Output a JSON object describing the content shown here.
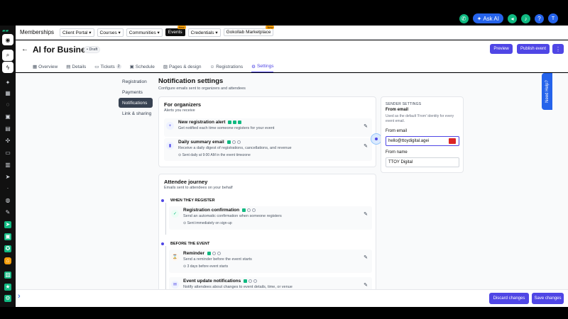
{
  "topbar": {
    "ask_ai": "Ask AI",
    "avatar": "T"
  },
  "appbar": {
    "title": "Memberships",
    "nav": [
      {
        "label": "Client Portal ▾",
        "badge": ""
      },
      {
        "label": "Courses ▾",
        "badge": ""
      },
      {
        "label": "Communities ▾",
        "badge": ""
      },
      {
        "label": "Events",
        "badge": "New"
      },
      {
        "label": "Credentials ▾",
        "badge": ""
      },
      {
        "label": "Gokollab Marketplace",
        "badge": "New"
      }
    ]
  },
  "header": {
    "title": "AI for Business",
    "status": "• Draft",
    "preview": "Preview",
    "publish": "Publish event",
    "more": "⋮"
  },
  "tabs": [
    {
      "label": "Overview",
      "icon": "grid-icon",
      "glyph": "▦",
      "count": ""
    },
    {
      "label": "Details",
      "icon": "doc-icon",
      "glyph": "▤",
      "count": ""
    },
    {
      "label": "Tickets",
      "icon": "ticket-icon",
      "glyph": "▭",
      "count": "2"
    },
    {
      "label": "Schedule",
      "icon": "calendar-icon",
      "glyph": "▣",
      "count": ""
    },
    {
      "label": "Pages & design",
      "icon": "image-icon",
      "glyph": "▨",
      "count": ""
    },
    {
      "label": "Registrations",
      "icon": "people-icon",
      "glyph": "☺",
      "count": ""
    },
    {
      "label": "Settings",
      "icon": "gear-icon",
      "glyph": "⚙",
      "count": ""
    }
  ],
  "settings_nav": [
    "Registration",
    "Payments",
    "Notifications",
    "Link & sharing"
  ],
  "section": {
    "title": "Notification settings",
    "subtitle": "Configure emails sent to organizers and attendees"
  },
  "organizers": {
    "title": "For organizers",
    "subtitle": "Alerts you receive",
    "items": [
      {
        "name": "New registration alert",
        "desc": "Get notified each time someone registers for your event",
        "time": "",
        "glyph": "+"
      },
      {
        "name": "Daily summary email",
        "desc": "Receive a daily digest of registrations, cancellations, and revenue",
        "time": "⊙ Sent daily at 9:00 AM in the event timezone",
        "glyph": "▮"
      }
    ]
  },
  "attendees": {
    "title": "Attendee journey",
    "subtitle": "Emails sent to attendees on your behalf",
    "phases": [
      {
        "label": "WHEN THEY REGISTER"
      },
      {
        "label": "BEFORE THE EVENT"
      }
    ],
    "items": [
      {
        "name": "Registration confirmation",
        "desc": "Send an automatic confirmation when someone registers",
        "time": "⊙ Sent immediately on sign-up",
        "glyph": "✓"
      },
      {
        "name": "Reminder",
        "desc": "Send a reminder before the event starts",
        "time": "⊙ 3 days before event starts",
        "glyph": "⌛"
      },
      {
        "name": "Event update notifications",
        "desc": "Notify attendees about changes to event details, time, or venue",
        "time": "",
        "glyph": "✉"
      }
    ]
  },
  "sender": {
    "heading": "SENDER SETTINGS",
    "title": "From email",
    "desc": "Used as the default 'From' identity for every event email.",
    "from_email_label": "From email",
    "from_email_value": "hello@ttoydigital.agei",
    "from_name_label": "From name",
    "from_name_value": "TTOY Digital"
  },
  "help": "Need Help?",
  "footer": {
    "discard": "Discard changes",
    "save": "Save changes"
  },
  "colors": {
    "accent": "#4f46e5",
    "whatsapp": "#10b981",
    "help": "#2563eb"
  }
}
